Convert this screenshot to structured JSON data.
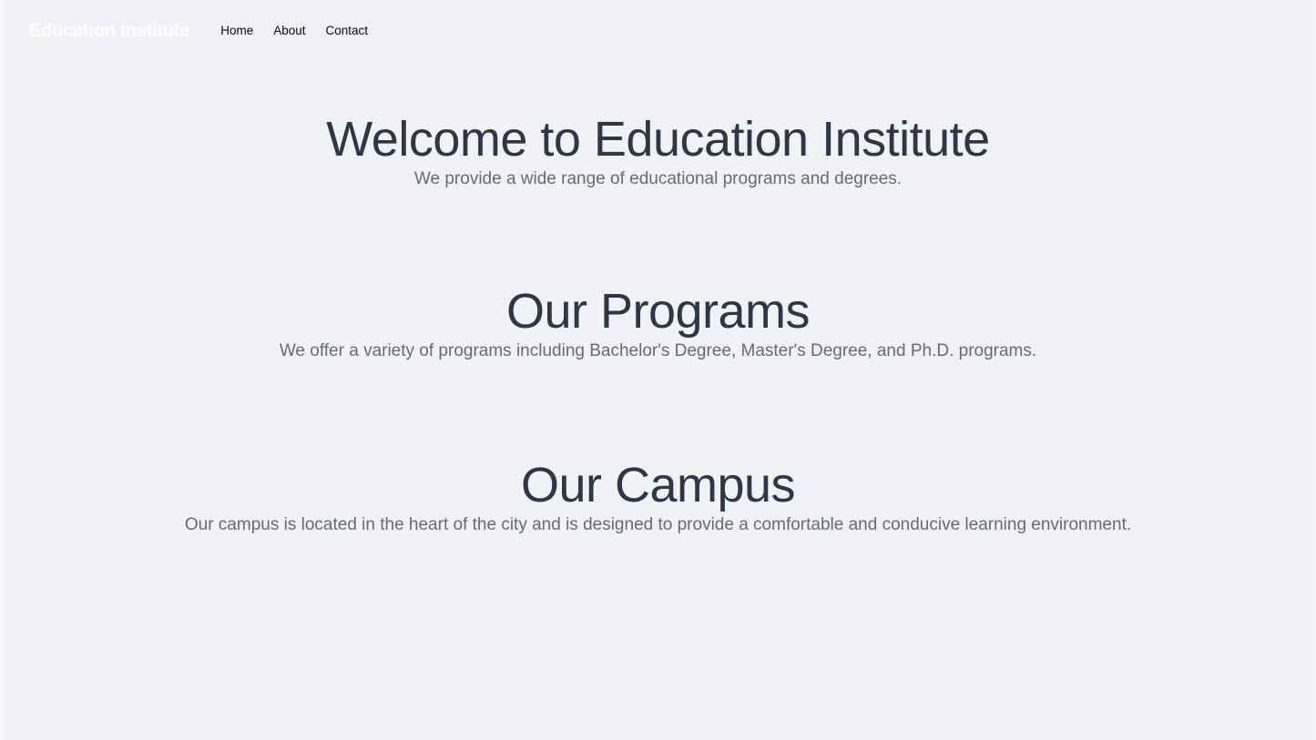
{
  "site": {
    "background_color": "#f1f2f6",
    "heading_color": "#2d3748",
    "body_text_color": "#646b77",
    "brand_color": "#ffffff",
    "nav_link_color": "#0a0a0a"
  },
  "navbar": {
    "brand": "Education Institute",
    "links": [
      {
        "label": "Home"
      },
      {
        "label": "About"
      },
      {
        "label": "Contact"
      }
    ]
  },
  "sections": [
    {
      "id": "hero",
      "title": "Welcome to Education Institute",
      "text": "We provide a wide range of educational programs and degrees."
    },
    {
      "id": "programs",
      "title": "Our Programs",
      "text": "We offer a variety of programs including Bachelor's Degree, Master's Degree, and Ph.D. programs."
    },
    {
      "id": "campus",
      "title": "Our Campus",
      "text": "Our campus is located in the heart of the city and is designed to provide a comfortable and conducive learning environment."
    }
  ]
}
